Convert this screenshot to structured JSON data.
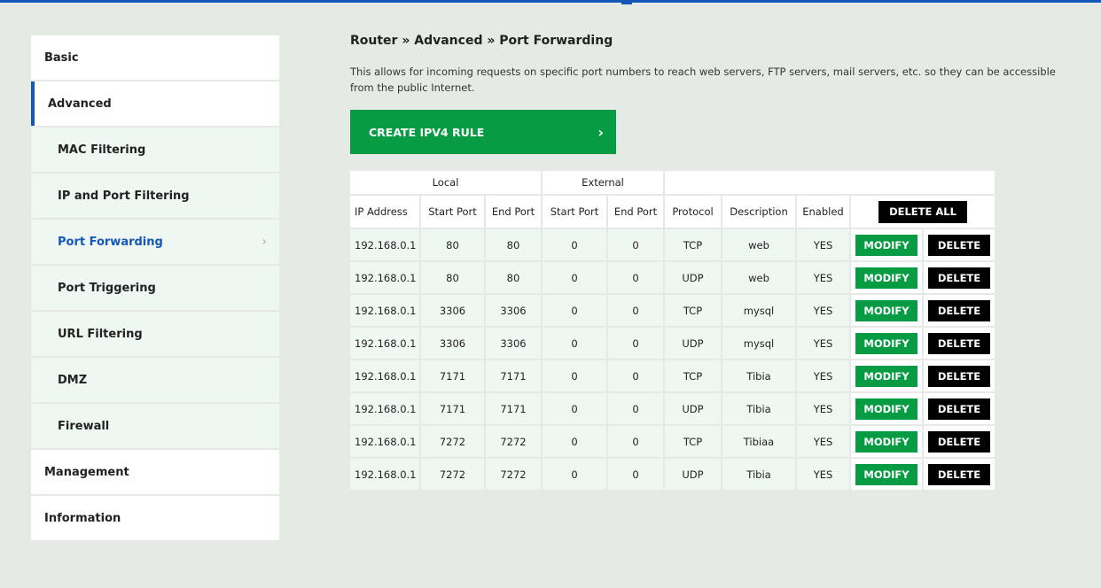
{
  "colors": {
    "accent": "#1457b8",
    "green": "#079c43",
    "black": "#000000"
  },
  "sidebar": {
    "items": [
      {
        "label": "Basic"
      },
      {
        "label": "Advanced"
      },
      {
        "label": "MAC Filtering"
      },
      {
        "label": "IP and Port Filtering"
      },
      {
        "label": "Port Forwarding"
      },
      {
        "label": "Port Triggering"
      },
      {
        "label": "URL Filtering"
      },
      {
        "label": "DMZ"
      },
      {
        "label": "Firewall"
      },
      {
        "label": "Management"
      },
      {
        "label": "Information"
      }
    ]
  },
  "main": {
    "breadcrumb": "Router » Advanced » Port Forwarding",
    "description": "This allows for incoming requests on specific port numbers to reach web servers, FTP servers, mail servers, etc. so they can be accessible from the public Internet.",
    "create_label": "CREATE IPV4 RULE",
    "create_icon": "chevron-right-icon"
  },
  "table": {
    "groups": [
      "Local",
      "External"
    ],
    "headers": [
      "IP Address",
      "Start Port",
      "End Port",
      "Start Port",
      "End Port",
      "Protocol",
      "Description",
      "Enabled"
    ],
    "delete_all": "DELETE ALL",
    "modify": "MODIFY",
    "delete": "DELETE",
    "rows": [
      [
        "192.168.0.1",
        "80",
        "80",
        "0",
        "0",
        "TCP",
        "web",
        "YES"
      ],
      [
        "192.168.0.1",
        "80",
        "80",
        "0",
        "0",
        "UDP",
        "web",
        "YES"
      ],
      [
        "192.168.0.1",
        "3306",
        "3306",
        "0",
        "0",
        "TCP",
        "mysql",
        "YES"
      ],
      [
        "192.168.0.1",
        "3306",
        "3306",
        "0",
        "0",
        "UDP",
        "mysql",
        "YES"
      ],
      [
        "192.168.0.1",
        "7171",
        "7171",
        "0",
        "0",
        "TCP",
        "Tibia",
        "YES"
      ],
      [
        "192.168.0.1",
        "7171",
        "7171",
        "0",
        "0",
        "UDP",
        "Tibia",
        "YES"
      ],
      [
        "192.168.0.1",
        "7272",
        "7272",
        "0",
        "0",
        "TCP",
        "Tibiaa",
        "YES"
      ],
      [
        "192.168.0.1",
        "7272",
        "7272",
        "0",
        "0",
        "UDP",
        "Tibia",
        "YES"
      ]
    ]
  }
}
